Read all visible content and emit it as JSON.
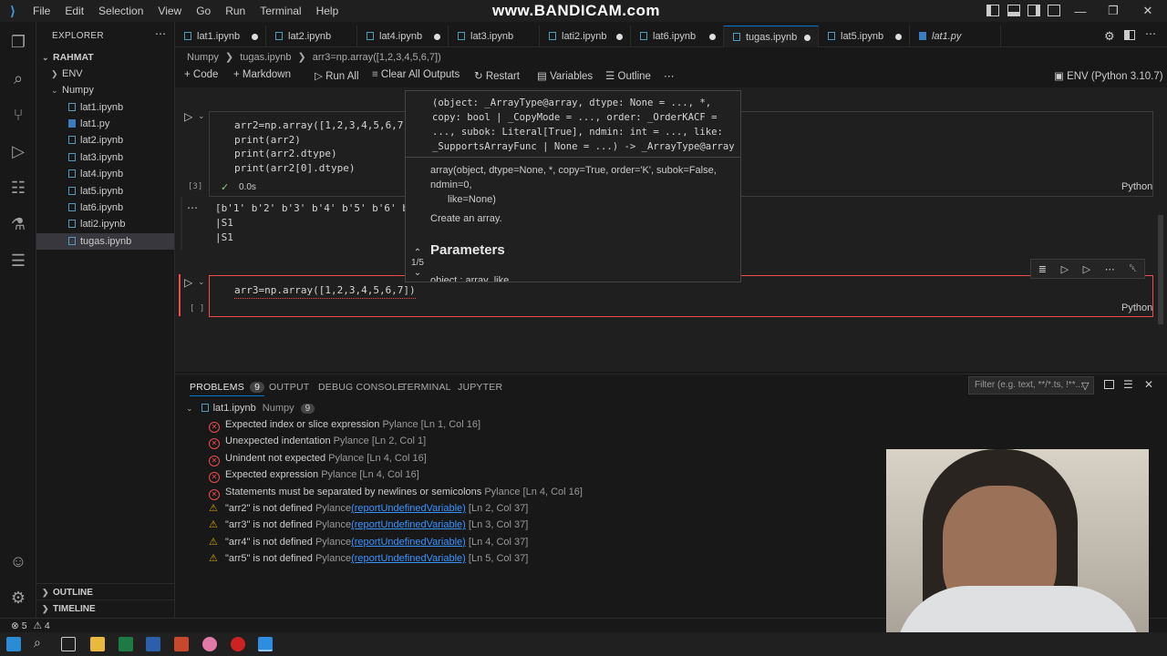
{
  "titlebar": {
    "menu": [
      "File",
      "Edit",
      "Selection",
      "View",
      "Go",
      "Run",
      "Terminal",
      "Help"
    ],
    "watermark": "www.BANDICAM.com"
  },
  "sidebar": {
    "title": "EXPLORER",
    "root": "RAHMAT",
    "items": [
      {
        "label": "ENV",
        "kind": "folder"
      },
      {
        "label": "Numpy",
        "kind": "folder-open"
      },
      {
        "label": "lat1.ipynb",
        "kind": "nb"
      },
      {
        "label": "lat1.py",
        "kind": "py"
      },
      {
        "label": "lat2.ipynb",
        "kind": "nb"
      },
      {
        "label": "lat3.ipynb",
        "kind": "nb"
      },
      {
        "label": "lat4.ipynb",
        "kind": "nb"
      },
      {
        "label": "lat5.ipynb",
        "kind": "nb"
      },
      {
        "label": "lat6.ipynb",
        "kind": "nb"
      },
      {
        "label": "lati2.ipynb",
        "kind": "nb"
      },
      {
        "label": "tugas.ipynb",
        "kind": "nb"
      }
    ],
    "outline": "OUTLINE",
    "timeline": "TIMELINE"
  },
  "tabs": [
    "lat1.ipynb",
    "lat2.ipynb",
    "lat4.ipynb",
    "lat3.ipynb",
    "lati2.ipynb",
    "lat6.ipynb",
    "tugas.ipynb",
    "lat5.ipynb",
    "lat1.py"
  ],
  "breadcrumb": [
    "Numpy",
    "tugas.ipynb",
    "arr3=np.array([1,2,3,4,5,6,7])"
  ],
  "toolbar": {
    "code": "Code",
    "markdown": "Markdown",
    "run_all": "Run All",
    "clear": "Clear All Outputs",
    "restart": "Restart",
    "variables": "Variables",
    "outline": "Outline",
    "more": "⋯",
    "kernel": "ENV (Python 3.10.7)"
  },
  "cell1": {
    "lines": [
      "arr2=np.array([1,2,3,4,5,6,7]",
      "print(arr2)",
      "print(arr2.dtype)",
      "print(arr2[0].dtype)"
    ],
    "exec_count": "[3]",
    "check": "✓",
    "time": "0.0s",
    "lang": "Python",
    "output": [
      "[b'1' b'2' b'3' b'4' b'5' b'6' b",
      "|S1",
      "|S1"
    ]
  },
  "cell2": {
    "code": "arr3=np.array([1,2,3,4,5,6,7])",
    "exec_count": "[ ]",
    "lang": "Python"
  },
  "hover": {
    "signature": [
      "(object: _ArrayType@array, dtype: None = ..., *,",
      "copy: bool | _CopyMode = ..., order: _OrderKACF =",
      "..., subok: Literal[True], ndmin: int = ..., like:",
      "_SupportsArrayFunc | None = ...) -> _ArrayType@array"
    ],
    "doc_sig": [
      "array(object, dtype=None, *, copy=True, order='K', subok=False,",
      "ndmin=0,",
      "like=None)"
    ],
    "desc": "Create an array.",
    "params_heading": "Parameters",
    "param_partial": "object : array_like",
    "counter": "1/5"
  },
  "panel": {
    "tabs": [
      "PROBLEMS",
      "OUTPUT",
      "DEBUG CONSOLE",
      "TERMINAL",
      "JUPYTER"
    ],
    "problem_count": "9",
    "filter_placeholder": "Filter (e.g. text, **/*.ts, !**...",
    "file": "lat1.ipynb",
    "folder": "Numpy",
    "file_count": "9",
    "problems": [
      {
        "type": "error",
        "msg": "Expected index or slice expression",
        "src": "Pylance",
        "link": "",
        "loc": "[Ln 1, Col 16]"
      },
      {
        "type": "error",
        "msg": "Unexpected indentation",
        "src": "Pylance",
        "link": "",
        "loc": "[Ln 2, Col 1]"
      },
      {
        "type": "error",
        "msg": "Unindent not expected",
        "src": "Pylance",
        "link": "",
        "loc": "[Ln 4, Col 16]"
      },
      {
        "type": "error",
        "msg": "Expected expression",
        "src": "Pylance",
        "link": "",
        "loc": "[Ln 4, Col 16]"
      },
      {
        "type": "error",
        "msg": "Statements must be separated by newlines or semicolons",
        "src": "Pylance",
        "link": "",
        "loc": "[Ln 4, Col 16]"
      },
      {
        "type": "warning",
        "msg": "\"arr2\" is not defined",
        "src": "Pylance",
        "link": "(reportUndefinedVariable)",
        "loc": "[Ln 2, Col 37]"
      },
      {
        "type": "warning",
        "msg": "\"arr3\" is not defined",
        "src": "Pylance",
        "link": "(reportUndefinedVariable)",
        "loc": "[Ln 3, Col 37]"
      },
      {
        "type": "warning",
        "msg": "\"arr4\" is not defined",
        "src": "Pylance",
        "link": "(reportUndefinedVariable)",
        "loc": "[Ln 4, Col 37]"
      },
      {
        "type": "warning",
        "msg": "\"arr5\" is not defined",
        "src": "Pylance",
        "link": "(reportUndefinedVariable)",
        "loc": "[Ln 5, Col 37]"
      }
    ]
  },
  "status": {
    "errors": "5",
    "warnings": "4"
  },
  "colors": {
    "accent": "#0078d4",
    "error": "#f14c4c",
    "warning": "#cca700",
    "link": "#3794ff"
  }
}
